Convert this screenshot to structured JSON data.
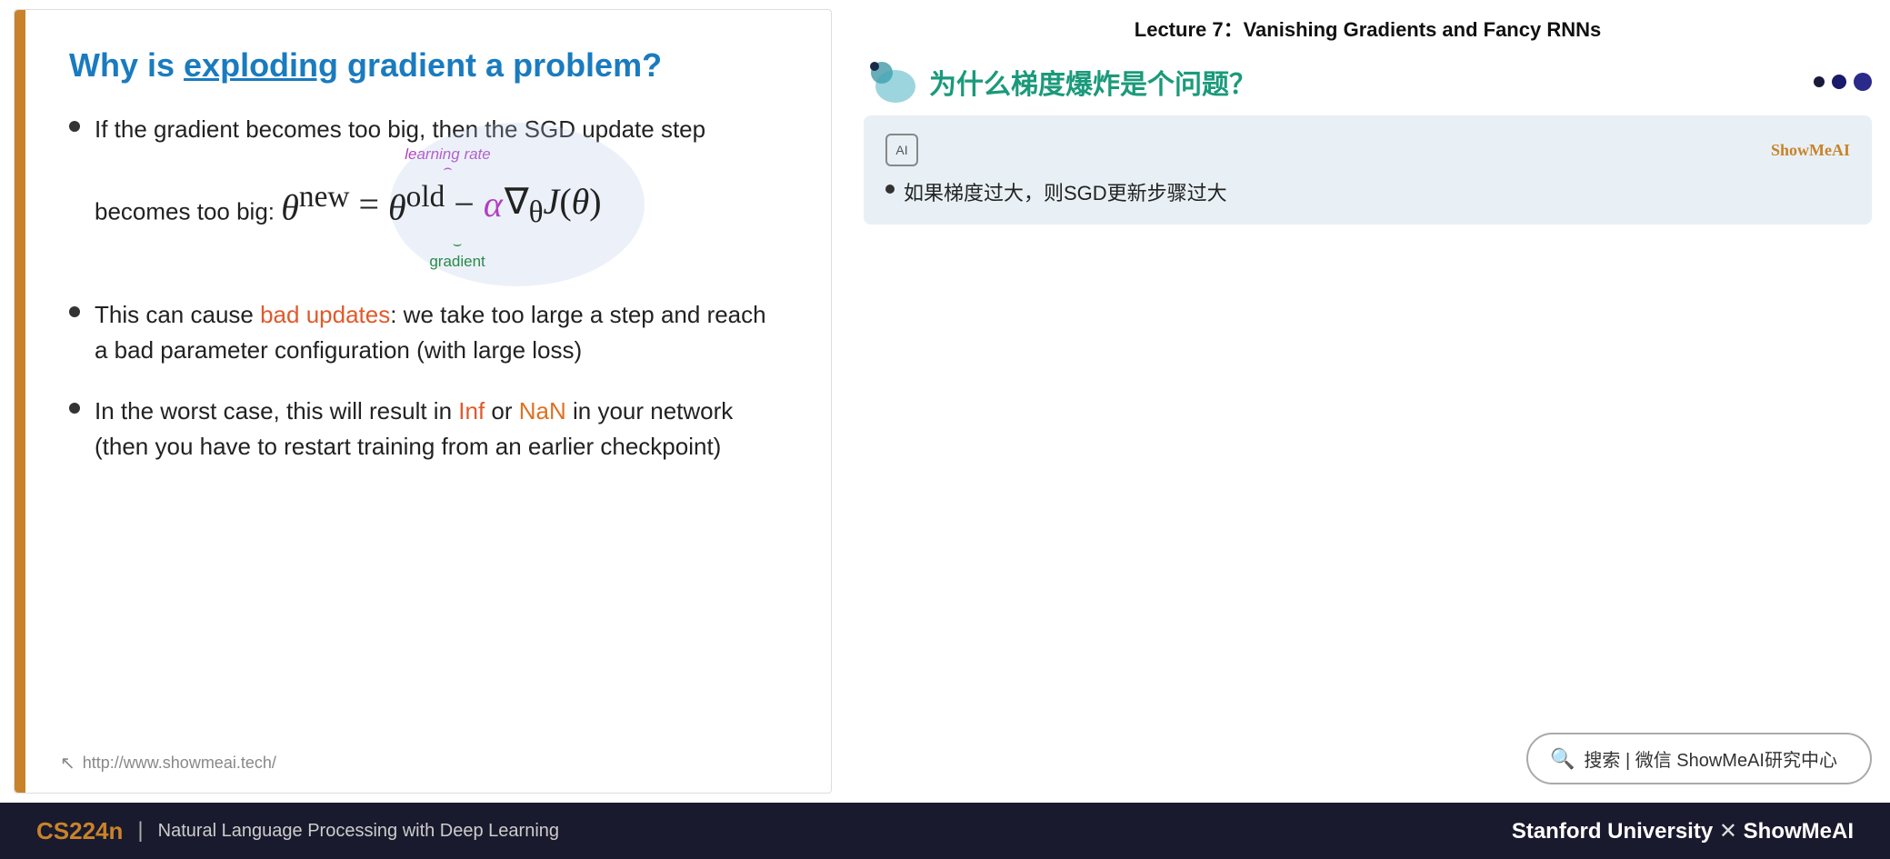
{
  "lecture": {
    "title": "Lecture 7：Vanishing Gradients and Fancy RNNs"
  },
  "slide": {
    "left_bar_color": "#c8832a",
    "title_plain": "Why is ",
    "title_underline": "exploding",
    "title_rest": " gradient a problem?",
    "title_color": "#1a7bbf",
    "bullets": [
      {
        "id": 1,
        "text_before": "If the gradient becomes too big, then the SGD update step becomes too big:"
      },
      {
        "id": 2,
        "text_before": "This can cause ",
        "text_highlight": "bad updates",
        "text_after": ": we take too large a step and reach a bad parameter configuration (with large loss)"
      },
      {
        "id": 3,
        "text_before": "In the worst case, this will result in ",
        "text_inf": "Inf",
        "text_middle": " or ",
        "text_nan": "NaN",
        "text_after": " in your network (then you have to restart training from an earlier checkpoint)"
      }
    ],
    "formula_lr_label": "learning rate",
    "formula_gradient_label": "gradient",
    "url": "http://www.showmeai.tech/"
  },
  "chinese_panel": {
    "title": "为什么梯度爆炸是个问题？",
    "title_color": "#1a9a7a",
    "card": {
      "ai_label": "AI",
      "brand": "ShowMeAI",
      "bullet_text": "如果梯度过大，则SGD更新步骤过大"
    }
  },
  "search": {
    "placeholder": "搜索 | 微信 ShowMeAI研究中心"
  },
  "footer": {
    "course": "CS224n",
    "separator": "|",
    "description": "Natural Language Processing with Deep Learning",
    "right_text": "Stanford University",
    "right_x": "✕",
    "right_brand": "ShowMeAI"
  }
}
